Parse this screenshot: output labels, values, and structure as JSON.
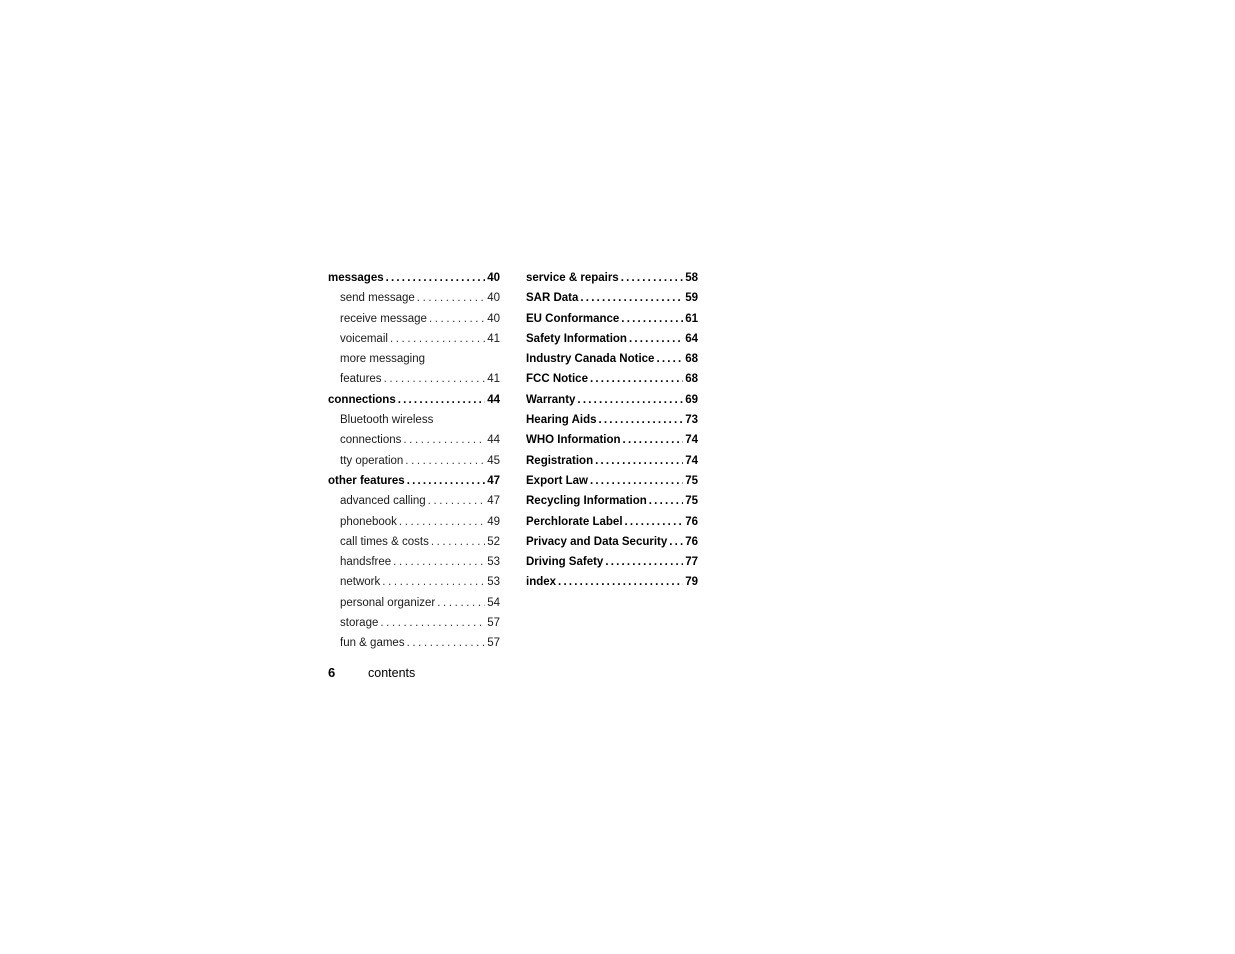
{
  "document": {
    "footer": {
      "page_number": "6",
      "label": "contents"
    }
  },
  "toc": {
    "left_column": [
      {
        "level": 1,
        "label": "messages",
        "page": "40",
        "dots": true
      },
      {
        "level": 2,
        "label": "send message",
        "page": "40",
        "dots": true
      },
      {
        "level": 2,
        "label": "receive message",
        "page": "40",
        "dots": true
      },
      {
        "level": 2,
        "label": "voicemail",
        "page": "41",
        "dots": true
      },
      {
        "level": 2,
        "label": "more messaging",
        "page": "",
        "dots": false
      },
      {
        "level": 2,
        "label": "features",
        "page": "41",
        "dots": true
      },
      {
        "level": 1,
        "label": "connections",
        "page": "44",
        "dots": true
      },
      {
        "level": 2,
        "label": "Bluetooth wireless",
        "page": "",
        "dots": false
      },
      {
        "level": 2,
        "label": "connections",
        "page": "44",
        "dots": true
      },
      {
        "level": 2,
        "label": "tty operation",
        "page": "45",
        "dots": true
      },
      {
        "level": 1,
        "label": "other features",
        "page": "47",
        "dots": true
      },
      {
        "level": 2,
        "label": "advanced calling",
        "page": "47",
        "dots": true
      },
      {
        "level": 2,
        "label": "phonebook",
        "page": "49",
        "dots": true
      },
      {
        "level": 2,
        "label": "call times & costs",
        "page": "52",
        "dots": true
      },
      {
        "level": 2,
        "label": "handsfree",
        "page": "53",
        "dots": true
      },
      {
        "level": 2,
        "label": "network",
        "page": "53",
        "dots": true
      },
      {
        "level": 2,
        "label": "personal organizer",
        "page": "54",
        "dots": true
      },
      {
        "level": 2,
        "label": "storage",
        "page": "57",
        "dots": true
      },
      {
        "level": 2,
        "label": "fun & games",
        "page": "57",
        "dots": true
      }
    ],
    "right_column": [
      {
        "level": 1,
        "label": "service & repairs",
        "page": "58",
        "dots": true
      },
      {
        "level": 1,
        "label": "SAR Data",
        "page": "59",
        "dots": true
      },
      {
        "level": 1,
        "label": "EU Conformance",
        "page": "61",
        "dots": true
      },
      {
        "level": 1,
        "label": "Safety Information",
        "page": "64",
        "dots": true
      },
      {
        "level": 1,
        "label": "Industry Canada Notice",
        "page": "68",
        "dots": true
      },
      {
        "level": 1,
        "label": "FCC Notice",
        "page": "68",
        "dots": true
      },
      {
        "level": 1,
        "label": "Warranty",
        "page": "69",
        "dots": true
      },
      {
        "level": 1,
        "label": "Hearing Aids",
        "page": "73",
        "dots": true
      },
      {
        "level": 1,
        "label": "WHO Information",
        "page": "74",
        "dots": true
      },
      {
        "level": 1,
        "label": "Registration",
        "page": "74",
        "dots": true
      },
      {
        "level": 1,
        "label": "Export Law",
        "page": "75",
        "dots": true
      },
      {
        "level": 1,
        "label": "Recycling Information",
        "page": "75",
        "dots": true
      },
      {
        "level": 1,
        "label": "Perchlorate Label",
        "page": "76",
        "dots": true
      },
      {
        "level": 1,
        "label": "Privacy and Data Security",
        "page": "76",
        "dots": true
      },
      {
        "level": 1,
        "label": "Driving Safety",
        "page": "77",
        "dots": true
      },
      {
        "level": 1,
        "label": "index",
        "page": "79",
        "dots": true
      }
    ]
  }
}
